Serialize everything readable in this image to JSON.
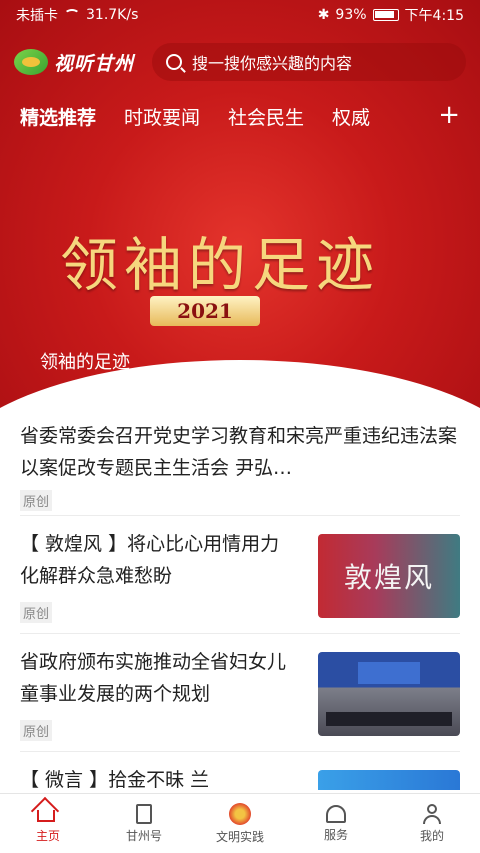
{
  "status": {
    "carrier": "未插卡",
    "speed": "31.7K/s",
    "battery": "93%",
    "time": "下午4:15"
  },
  "header": {
    "app_name": "视听甘州",
    "search_placeholder": "搜一搜你感兴趣的内容"
  },
  "tabs": [
    {
      "label": "精选推荐"
    },
    {
      "label": "时政要闻"
    },
    {
      "label": "社会民生"
    },
    {
      "label": "权威"
    }
  ],
  "tabs_more": "+",
  "banner": {
    "title": "领袖的足迹",
    "year": "2021",
    "caption": "领袖的足迹"
  },
  "feed": [
    {
      "title": "省委常委会召开党史学习教育和宋亮严重违纪违法案以案促改专题民主生活会  尹弘…",
      "tag": "原创"
    },
    {
      "title": "【 敦煌风 】将心比心用情用力  化解群众急难愁盼",
      "tag": "原创",
      "thumb_text": "敦煌风"
    },
    {
      "title": "省政府颁布实施推动全省妇女儿童事业发展的两个规划",
      "tag": "原创"
    },
    {
      "title": "【 微言 】拾金不昧  兰",
      "tag": ""
    }
  ],
  "nav": [
    {
      "label": "主页",
      "icon": "home-icon"
    },
    {
      "label": "甘州号",
      "icon": "document-icon"
    },
    {
      "label": "文明实践",
      "icon": "emblem-icon"
    },
    {
      "label": "服务",
      "icon": "heart-hands-icon"
    },
    {
      "label": "我的",
      "icon": "user-icon"
    }
  ],
  "colors": {
    "brand_red": "#d51c1c"
  }
}
